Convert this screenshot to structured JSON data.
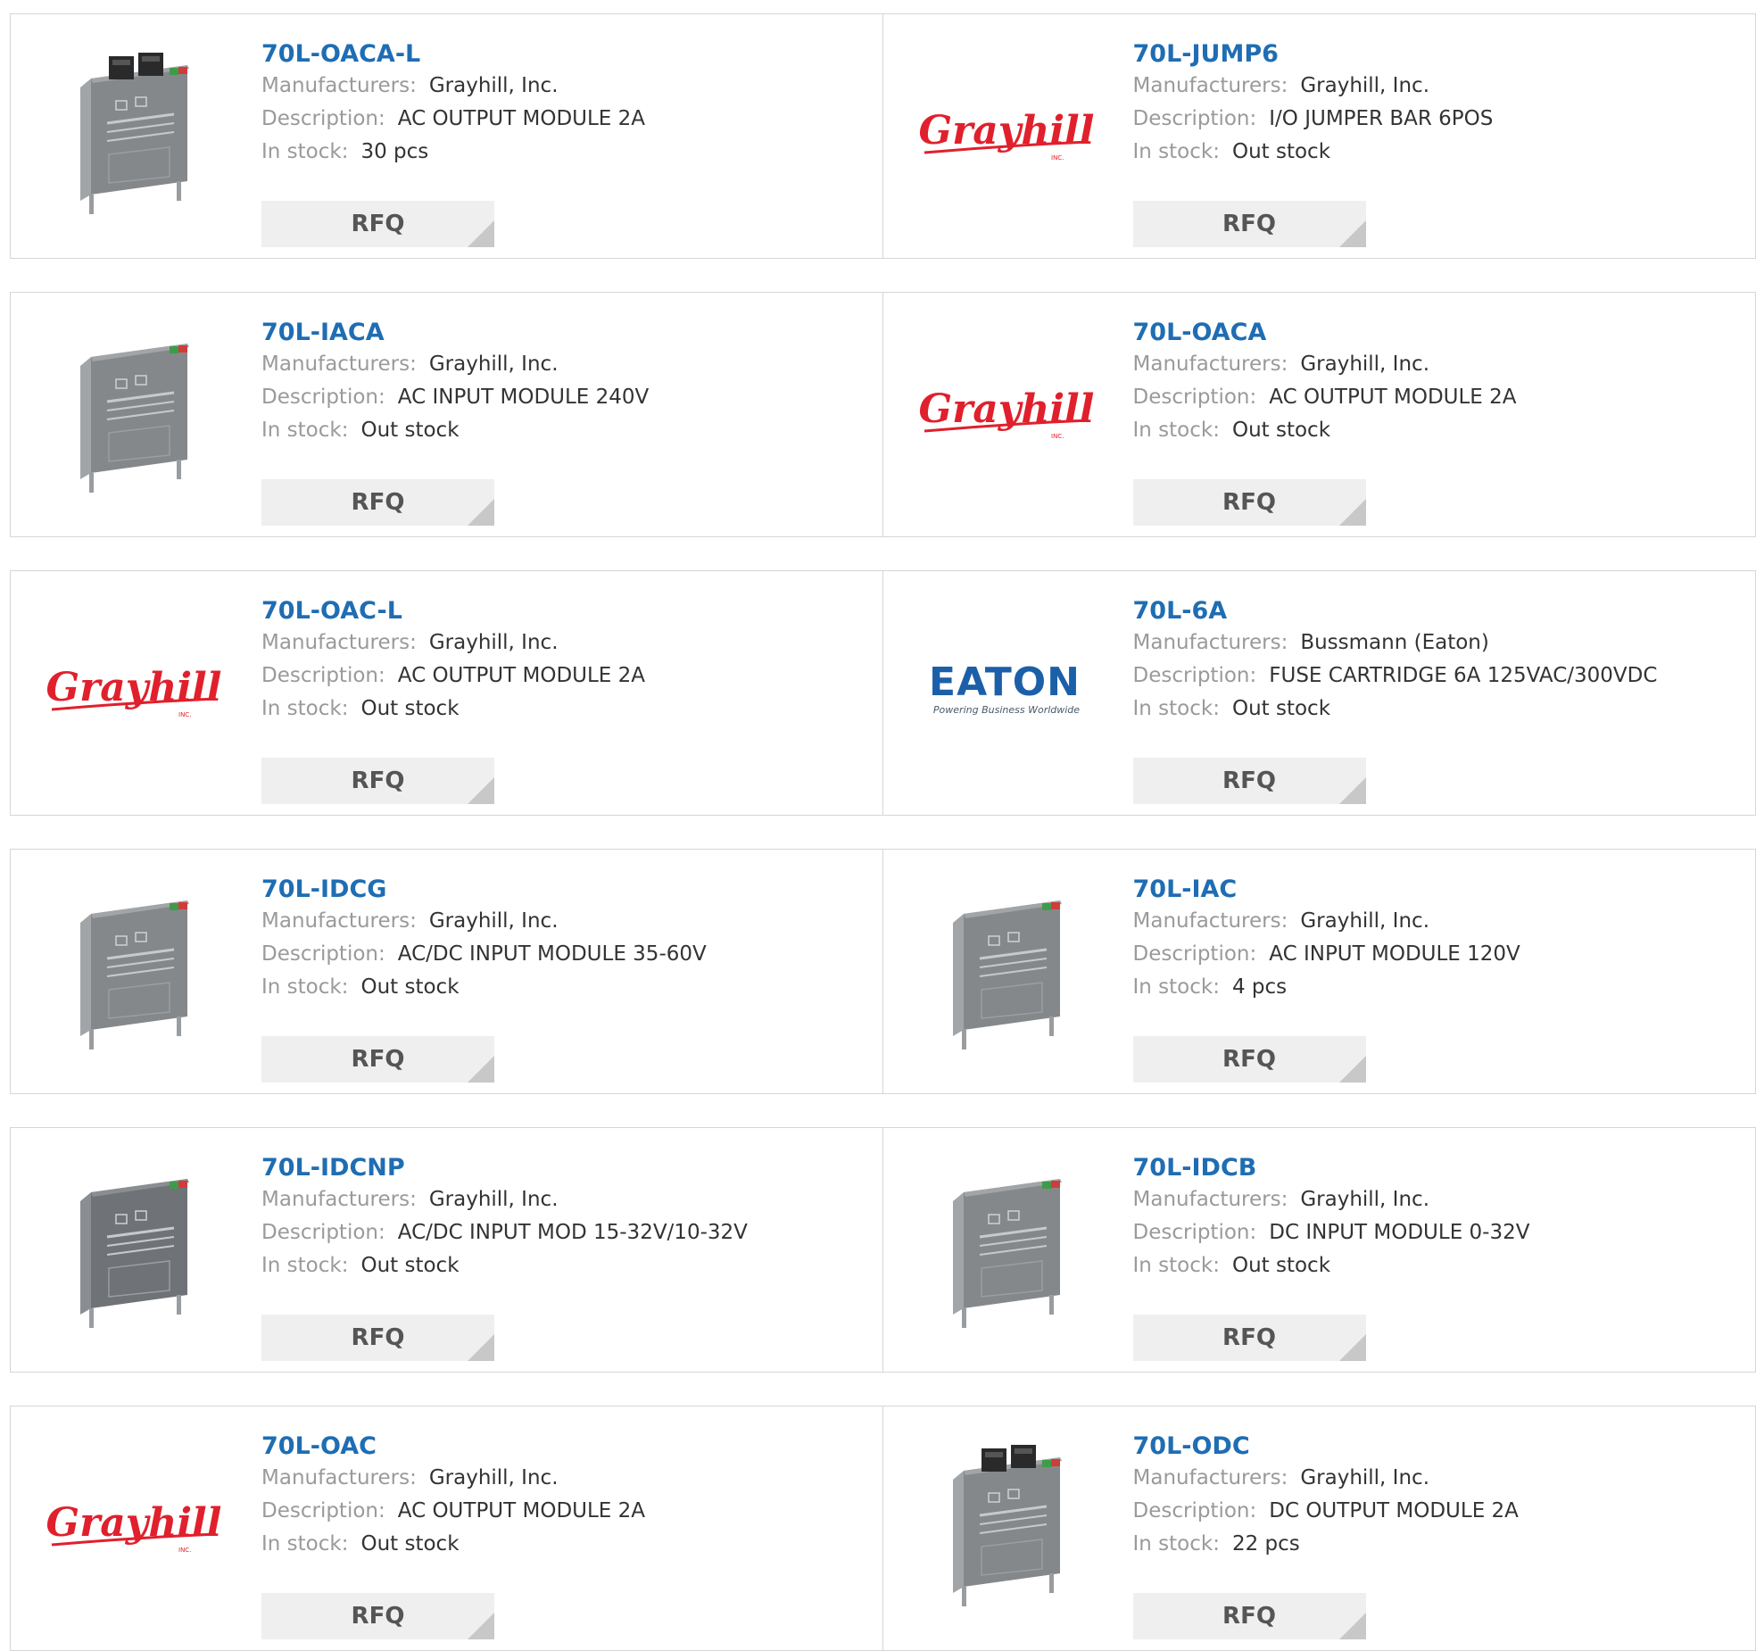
{
  "labels": {
    "manufacturers": "Manufacturers:",
    "description": "Description:",
    "in_stock": "In stock:",
    "rfq": "RFQ"
  },
  "colors": {
    "link": "#1f6db3",
    "label": "#9a9a9a",
    "value": "#333333",
    "button_bg": "#efefef",
    "grayhill_red": "#e0202c",
    "eaton_blue": "#1b5fa8"
  },
  "rows": [
    {
      "items": [
        {
          "part": "70L-OACA-L",
          "manufacturer": "Grayhill, Inc.",
          "description": "AC OUTPUT MODULE 2A",
          "stock": "30 pcs",
          "image": "module-with-connectors"
        },
        {
          "part": "70L-JUMP6",
          "manufacturer": "Grayhill, Inc.",
          "description": "I/O JUMPER BAR 6POS",
          "stock": "Out stock",
          "image": "grayhill-logo",
          "logo_text": "Grayhill",
          "logo_sub": "INC."
        }
      ]
    },
    {
      "items": [
        {
          "part": "70L-IACA",
          "manufacturer": "Grayhill, Inc.",
          "description": "AC INPUT MODULE 240V",
          "stock": "Out stock",
          "image": "module"
        },
        {
          "part": "70L-OACA",
          "manufacturer": "Grayhill, Inc.",
          "description": "AC OUTPUT MODULE 2A",
          "stock": "Out stock",
          "image": "grayhill-logo",
          "logo_text": "Grayhill",
          "logo_sub": "INC."
        }
      ]
    },
    {
      "items": [
        {
          "part": "70L-OAC-L",
          "manufacturer": "Grayhill, Inc.",
          "description": "AC OUTPUT MODULE 2A",
          "stock": "Out stock",
          "image": "grayhill-logo",
          "logo_text": "Grayhill",
          "logo_sub": "INC."
        },
        {
          "part": "70L-6A",
          "manufacturer": "Bussmann (Eaton)",
          "description": "FUSE CARTRIDGE 6A 125VAC/300VDC",
          "stock": "Out stock",
          "image": "eaton-logo",
          "logo_text": "EATON",
          "logo_sub": "Powering Business Worldwide"
        }
      ]
    },
    {
      "items": [
        {
          "part": "70L-IDCG",
          "manufacturer": "Grayhill, Inc.",
          "description": "AC/DC INPUT MODULE 35-60V",
          "stock": "Out stock",
          "image": "module"
        },
        {
          "part": "70L-IAC",
          "manufacturer": "Grayhill, Inc.",
          "description": "AC INPUT MODULE 120V",
          "stock": "4 pcs",
          "image": "module"
        }
      ]
    },
    {
      "items": [
        {
          "part": "70L-IDCNP",
          "manufacturer": "Grayhill, Inc.",
          "description": "AC/DC INPUT MOD 15-32V/10-32V",
          "stock": "Out stock",
          "image": "module-dark"
        },
        {
          "part": "70L-IDCB",
          "manufacturer": "Grayhill, Inc.",
          "description": "DC INPUT MODULE 0-32V",
          "stock": "Out stock",
          "image": "module"
        }
      ]
    },
    {
      "items": [
        {
          "part": "70L-OAC",
          "manufacturer": "Grayhill, Inc.",
          "description": "AC OUTPUT MODULE 2A",
          "stock": "Out stock",
          "image": "grayhill-logo",
          "logo_text": "Grayhill",
          "logo_sub": "INC."
        },
        {
          "part": "70L-ODC",
          "manufacturer": "Grayhill, Inc.",
          "description": "DC OUTPUT MODULE 2A",
          "stock": "22 pcs",
          "image": "module-with-connectors"
        }
      ]
    }
  ]
}
